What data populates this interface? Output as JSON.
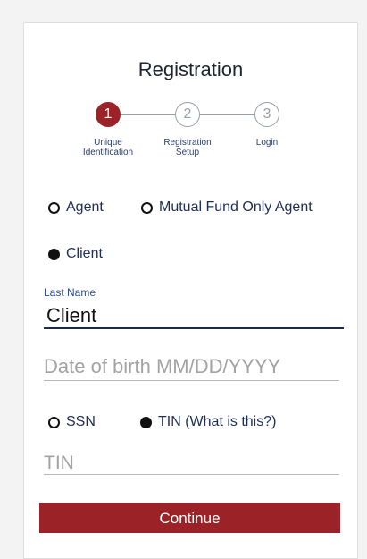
{
  "title": "Registration",
  "steps": [
    {
      "number": "1",
      "label_line1": "Unique",
      "label_line2": "Identification",
      "active": true
    },
    {
      "number": "2",
      "label_line1": "Registration",
      "label_line2": "Setup",
      "active": false
    },
    {
      "number": "3",
      "label_line1": "Login",
      "label_line2": "",
      "active": false
    }
  ],
  "role_options": {
    "agent": "Agent",
    "mutual_fund_agent": "Mutual Fund Only Agent",
    "client": "Client",
    "selected": "Client"
  },
  "last_name": {
    "label": "Last Name",
    "value": "Client"
  },
  "dob": {
    "placeholder": "Date of birth MM/DD/YYYY",
    "value": ""
  },
  "id_type": {
    "ssn": "SSN",
    "tin": "TIN (What is this?)",
    "selected": "TIN"
  },
  "tin_field": {
    "placeholder": "TIN",
    "value": ""
  },
  "continue_label": "Continue",
  "colors": {
    "brand": "#9b2226",
    "text_dark": "#1e2d55",
    "label_blue": "#2b4aa0"
  }
}
